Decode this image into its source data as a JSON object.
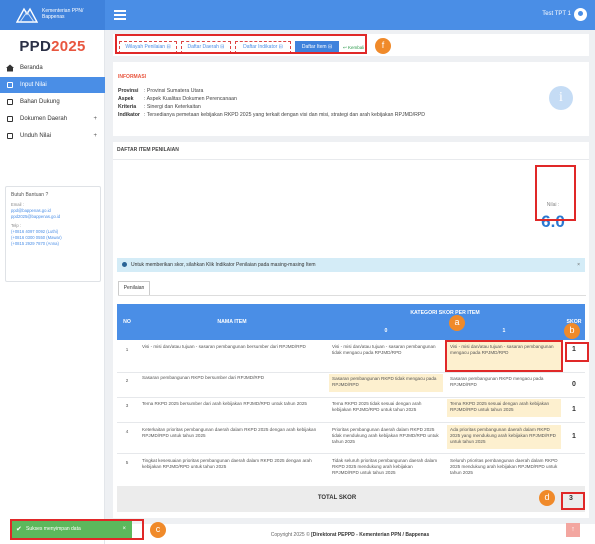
{
  "app": {
    "logo_text": "Kementerian PPN/ Bappenas",
    "brand_prefix": "PPD",
    "brand_year": "2025",
    "user_name": "Test TPT 1"
  },
  "sidebar": {
    "items": [
      {
        "label": "Beranda"
      },
      {
        "label": "Input Nilai"
      },
      {
        "label": "Bahan Dukung"
      },
      {
        "label": "Dokumen Daerah"
      },
      {
        "label": "Unduh Nilai"
      }
    ],
    "help": {
      "title": "Butuh Bantuan ?",
      "email_label": "Email :",
      "email1": "ppd@bappenas.go.id",
      "email2": "ppd2025@bappenas.go.id",
      "phone_label": "Telp :",
      "phone1": "(+0816 4097 0092 (Luthi)",
      "phone2": "(+0816 0300 0550 (Mawar)",
      "phone3": "(+0815 2929 7870 (Anna)"
    }
  },
  "tabs": [
    {
      "label": "Wilayah Penilaian ⊟"
    },
    {
      "label": "Daftar Daerah ⊟"
    },
    {
      "label": "Daftar Indikator ⊟"
    },
    {
      "label": "Daftar Item ⊟"
    }
  ],
  "kembali_label": "↩ Kembali",
  "info": {
    "title": "INFORMASI",
    "rows": [
      {
        "key": "Provinsi",
        "value": ": Provinsi Sumatera Utara"
      },
      {
        "key": "Aspek",
        "value": ": Aspek Kualitas Dokumen Perencanaan"
      },
      {
        "key": "Kriteria",
        "value": ": Sinergi dan Keterkaitan"
      },
      {
        "key": "Indikator",
        "value": ": Tersedianya pemetaan kebijakan RKPD 2025 yang terkait dengan visi dan misi, strategi dan arah kebijakan RPJMD/RPD"
      }
    ]
  },
  "item_card": {
    "title": "DAFTAR ITEM PENILAIAN",
    "score_label": "Nilai :",
    "score_value": "6.0",
    "alert": "Untuk memberikan skor, silahkan Klik Indikator Penilaian pada masing-masing Item",
    "tab_label": "Penilaian"
  },
  "table": {
    "headers": {
      "no": "NO",
      "nama": "NAMA ITEM",
      "kategori": "KATEGORI SKOR PER ITEM",
      "col0": "0",
      "col1": "1",
      "skor": "SKOR"
    },
    "rows": [
      {
        "no": "1",
        "nama": "Visi - misi dan/atau tujuan - sasaran pembangunan bersumber dari RPJMD/RPD",
        "k0": "Visi - misi dan/atau tujuan - sasaran pembangunan tidak mengacu pada RPJMD/RPD",
        "k1": "Visi - misi dan/atau tujuan - sasaran pembangunan mengacu pada RPJMD/RPD",
        "skor": "1",
        "hl": 1
      },
      {
        "no": "2",
        "nama": "Sasaran pembangunan RKPD bersumber dari RPJMD/RPD",
        "k0": "Sasaran pembangunan RKPD tidak mengacu pada RPJMD/RPD",
        "k1": "Sasaran pembangunan RKPD mengacu pada RPJMD/RPD",
        "skor": "0",
        "hl": 0
      },
      {
        "no": "3",
        "nama": "Tema RKPD 2025 bersumber dari arah kebijakan RPJMD/RPD untuk tahun 2025",
        "k0": "Tema RKPD 2025 tidak sesuai dengan arah kebijakan RPJMD/RPD untuk tahun 2025",
        "k1": "Tema RKPD 2025 sesuai dengan arah kebijakan RPJMD/RPD untuk tahun 2025",
        "skor": "1",
        "hl": 1
      },
      {
        "no": "4",
        "nama": "Keterkaitan prioritas pembangunan daerah dalam RKPD 2025 dengan arah kebijakan RPJMD/RPD untuk tahun 2025",
        "k0": "Prioritas pembangunan daerah dalam RKPD 2025 tidak mendukung arah kebijakan RPJMD/RPD untuk tahun 2025",
        "k1": "Ada prioritas pembangunan daerah dalam RKPD 2025 yang mendukung arah kebijakan RPJMD/RPD untuk tahun 2025",
        "skor": "1",
        "hl": 1
      },
      {
        "no": "5",
        "nama": "Tingkat kesesuaian prioritas pembangunan daerah dalam RKPD 2025 dengan arah kebijakan RPJMD/RPD untuk tahun 2025",
        "k0": "Tidak seluruh prioritas pembangunan daerah dalam RKPD 2025 mendukung arah kebijakan RPJMD/RPD untuk tahun 2025",
        "k1": "Seluruh prioritas pembangunan daerah dalam RKPD 2025 mendukung arah kebijakan RPJMD/RPD untuk tahun 2025",
        "skor": "",
        "hl": 1
      }
    ],
    "total_label": "TOTAL SKOR",
    "total_value": "3"
  },
  "callouts": {
    "a": "a",
    "b": "b",
    "c": "c",
    "d": "d",
    "f": "f"
  },
  "toast": {
    "check": "✔",
    "message": "Sukses menyimpan data",
    "close": "×"
  },
  "footer": {
    "prefix": "Copyright 2025 © ",
    "org": "[Direktorat PEPPD - Kementerian PPN / Bappenas"
  },
  "scroll_top_icon": "↑",
  "colors": {
    "primary": "#4a8ee6",
    "accent": "#e8563f",
    "highlight": "#fdf0cf",
    "toast": "#5cb85c",
    "callout": "#f08a2a"
  }
}
